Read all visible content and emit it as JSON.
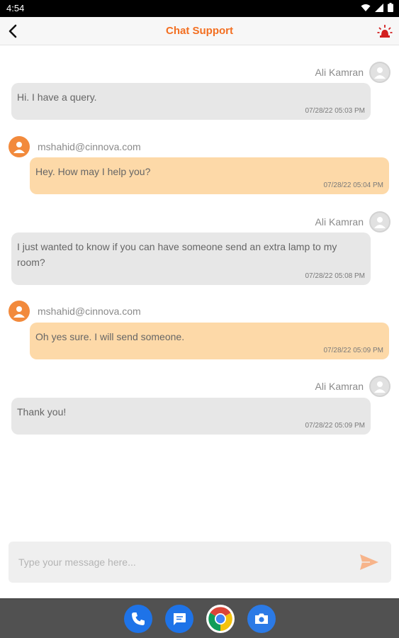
{
  "status_bar": {
    "time": "4:54",
    "icons": [
      "wifi-icon",
      "signal-icon",
      "battery-icon"
    ]
  },
  "header": {
    "title": "Chat Support",
    "back_icon": "chevron-left-icon",
    "alarm_icon": "emergency-siren-icon"
  },
  "colors": {
    "accent": "#f36f21",
    "agent_bubble": "#fdd9a8",
    "user_bubble": "#e7e7e7",
    "agent_avatar": "#f28a3c",
    "send_icon": "#f7b48a"
  },
  "messages": [
    {
      "sender": "Ali Kamran",
      "role": "user",
      "text": "Hi. I have a query.",
      "timestamp": "07/28/22 05:03 PM"
    },
    {
      "sender": "mshahid@cinnova.com",
      "role": "agent",
      "text": "Hey. How may I help you?",
      "timestamp": "07/28/22 05:04 PM"
    },
    {
      "sender": "Ali Kamran",
      "role": "user",
      "text": "I just wanted to know if you can have someone send an extra lamp to my room?",
      "timestamp": "07/28/22 05:08 PM"
    },
    {
      "sender": "mshahid@cinnova.com",
      "role": "agent",
      "text": "Oh yes sure. I will send someone.",
      "timestamp": "07/28/22 05:09 PM"
    },
    {
      "sender": "Ali Kamran",
      "role": "user",
      "text": "Thank you!",
      "timestamp": "07/28/22 05:09 PM"
    }
  ],
  "composer": {
    "placeholder": "Type your message here...",
    "value": "",
    "send_icon": "send-icon"
  },
  "dock": {
    "apps": [
      "phone-icon",
      "messages-icon",
      "chrome-icon",
      "camera-icon"
    ]
  }
}
